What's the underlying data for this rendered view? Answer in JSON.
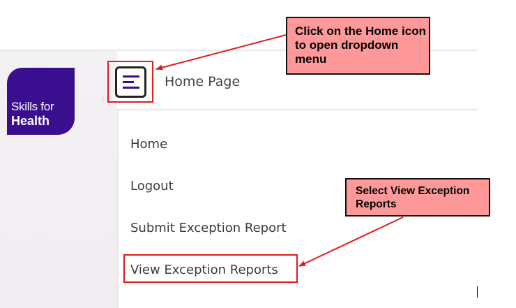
{
  "logo": {
    "line1": "Skills for",
    "line2": "Health"
  },
  "header": {
    "home_icon": "hamburger-menu-icon",
    "page_title": "Home Page"
  },
  "menu": {
    "items": [
      {
        "label": "Home"
      },
      {
        "label": "Logout"
      },
      {
        "label": "Submit Exception Report"
      },
      {
        "label": "View Exception Reports"
      }
    ]
  },
  "annotations": {
    "callout_home": "Click on the Home icon to open dropdown menu",
    "callout_view": "Select View Exception Reports"
  },
  "colors": {
    "brand_purple": "#3a0f8f",
    "callout_fill": "#ff9999",
    "highlight_red": "#e01b1b"
  }
}
